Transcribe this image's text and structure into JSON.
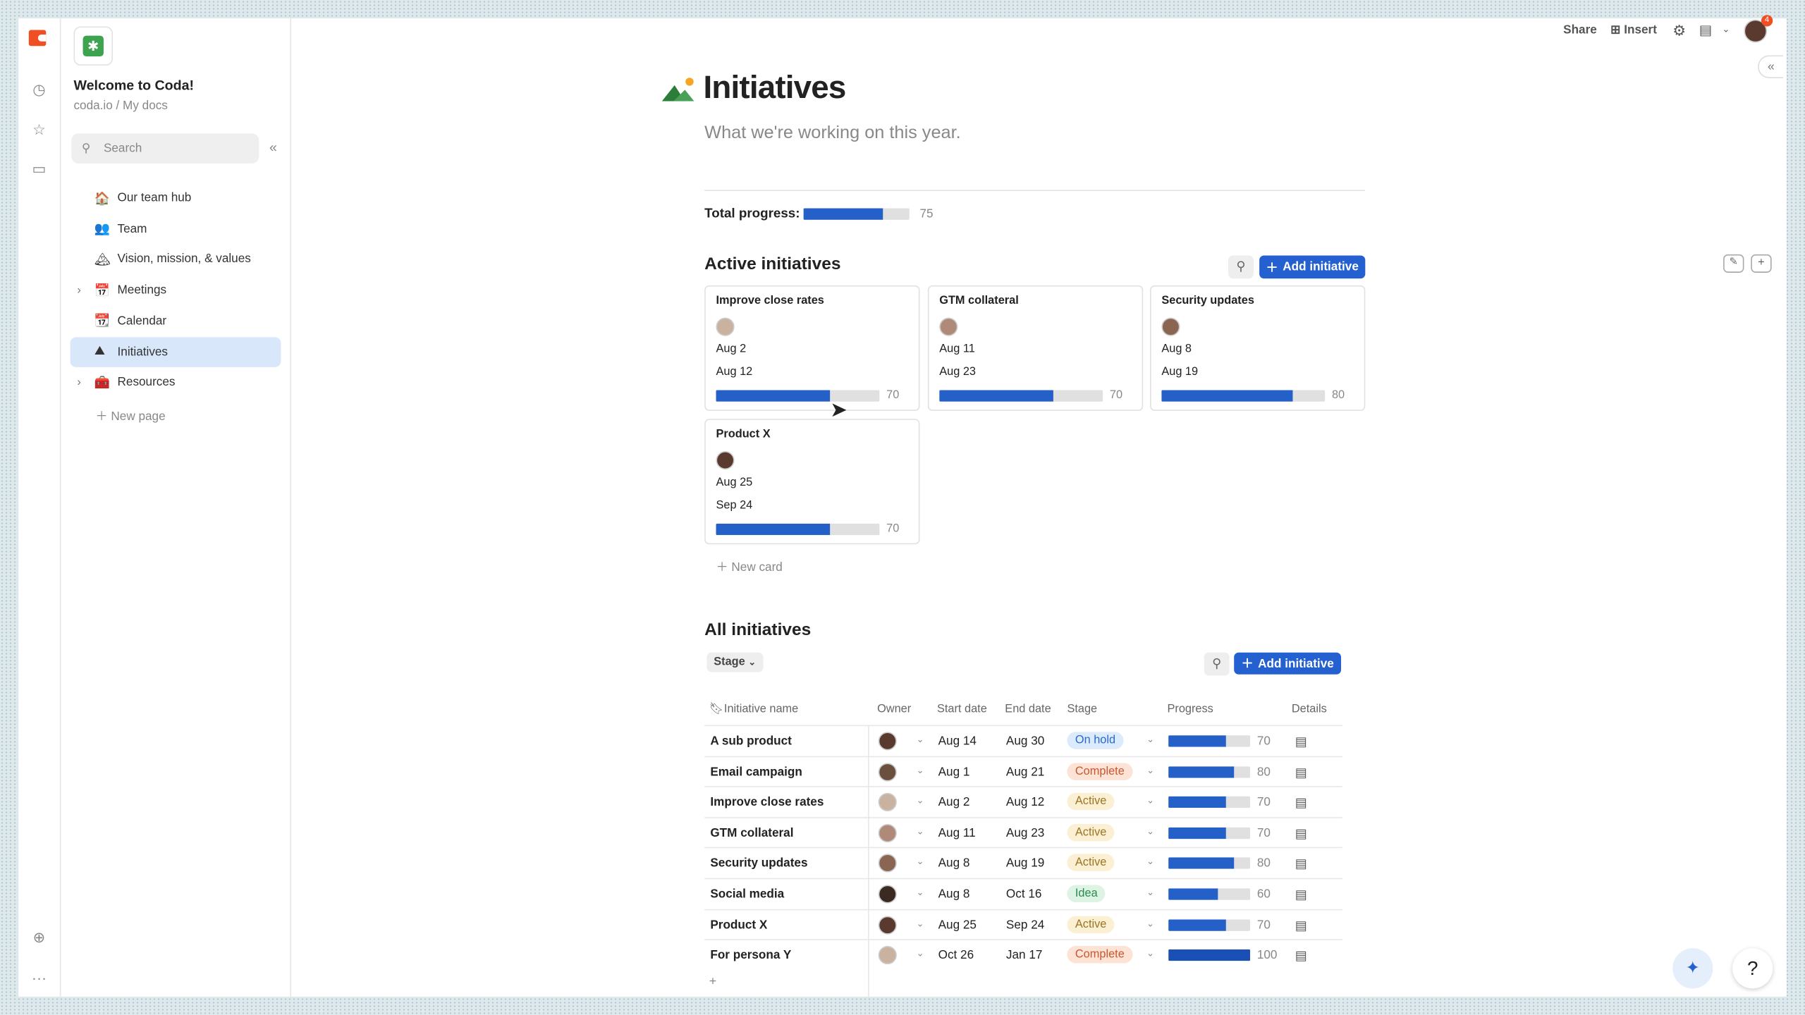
{
  "rail": {
    "icons": [
      "coda-logo",
      "clock-icon",
      "star-icon",
      "folder-icon",
      "add-circle-icon",
      "more-icon"
    ]
  },
  "sidebar": {
    "doc_title": "Welcome to Coda!",
    "breadcrumb": "coda.io / My docs",
    "search_placeholder": "Search",
    "items": [
      {
        "label": "Our team hub",
        "emoji": "🏠",
        "expandable": false
      },
      {
        "label": "Team",
        "emoji": "👥",
        "expandable": false
      },
      {
        "label": "Vision, mission, & values",
        "emoji": "🏔",
        "expandable": false
      },
      {
        "label": "Meetings",
        "emoji": "📅",
        "expandable": true
      },
      {
        "label": "Calendar",
        "emoji": "📆",
        "expandable": false
      },
      {
        "label": "Initiatives",
        "emoji": "⛰",
        "expandable": false,
        "selected": true
      },
      {
        "label": "Resources",
        "emoji": "🧰",
        "expandable": true
      }
    ],
    "new_page": "New page"
  },
  "toolbar": {
    "share": "Share",
    "insert": "Insert",
    "notification_count": "4"
  },
  "page": {
    "title": "Initiatives",
    "subtitle": "What we're working on this year.",
    "total_progress_label": "Total progress:",
    "total_progress": 75
  },
  "active": {
    "heading": "Active initiatives",
    "add_label": "Add initiative",
    "new_card": "New card",
    "cards": [
      {
        "title": "Improve close rates",
        "start": "Aug 2",
        "end": "Aug 12",
        "progress": 70,
        "avatar": "#c9b2a0"
      },
      {
        "title": "GTM collateral",
        "start": "Aug 11",
        "end": "Aug 23",
        "progress": 70,
        "avatar": "#b08a78"
      },
      {
        "title": "Security updates",
        "start": "Aug 8",
        "end": "Aug 19",
        "progress": 80,
        "avatar": "#8a6552"
      },
      {
        "title": "Product X",
        "start": "Aug 25",
        "end": "Sep 24",
        "progress": 70,
        "avatar": "#5a3a2e"
      }
    ]
  },
  "all": {
    "heading": "All initiatives",
    "filter": "Stage",
    "add_label": "Add initiative",
    "columns": [
      "Initiative name",
      "Owner",
      "Start date",
      "End date",
      "Stage",
      "Progress",
      "Details"
    ],
    "rows": [
      {
        "name": "A sub product",
        "start": "Aug 14",
        "end": "Aug 30",
        "stage": "On hold",
        "progress": 70,
        "avatar": "#5a3a2e"
      },
      {
        "name": "Email campaign",
        "start": "Aug 1",
        "end": "Aug 21",
        "stage": "Complete",
        "progress": 80,
        "avatar": "#6b5040"
      },
      {
        "name": "Improve close rates",
        "start": "Aug 2",
        "end": "Aug 12",
        "stage": "Active",
        "progress": 70,
        "avatar": "#c9b2a0"
      },
      {
        "name": "GTM collateral",
        "start": "Aug 11",
        "end": "Aug 23",
        "stage": "Active",
        "progress": 70,
        "avatar": "#b08a78"
      },
      {
        "name": "Security updates",
        "start": "Aug 8",
        "end": "Aug 19",
        "stage": "Active",
        "progress": 80,
        "avatar": "#8a6552"
      },
      {
        "name": "Social media",
        "start": "Aug 8",
        "end": "Oct 16",
        "stage": "Idea",
        "progress": 60,
        "avatar": "#3a2a22"
      },
      {
        "name": "Product X",
        "start": "Aug 25",
        "end": "Sep 24",
        "stage": "Active",
        "progress": 70,
        "avatar": "#5a3a2e"
      },
      {
        "name": "For persona Y",
        "start": "Oct 26",
        "end": "Jan 17",
        "stage": "Complete",
        "progress": 100,
        "avatar": "#c9b2a0"
      }
    ]
  },
  "stage_colors": {
    "On hold": {
      "bg": "#dcebfb",
      "fg": "#2a6acb"
    },
    "Complete": {
      "bg": "#fde3d6",
      "fg": "#c9572d"
    },
    "Active": {
      "bg": "#fcf0d4",
      "fg": "#9a7524"
    },
    "Idea": {
      "bg": "#ddf3e3",
      "fg": "#2b8a4c"
    }
  },
  "help": "?"
}
